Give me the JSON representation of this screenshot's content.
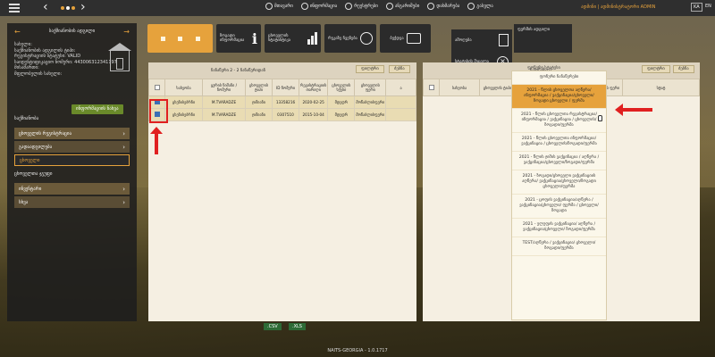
{
  "topbar": {
    "menu": [
      {
        "icon": "home-icon",
        "label": "მთავარი"
      },
      {
        "icon": "info-icon",
        "label": "ინფორმაცია"
      },
      {
        "icon": "list-icon",
        "label": "რეესტრები"
      },
      {
        "icon": "reports-icon",
        "label": "ანგარიშები"
      },
      {
        "icon": "help-icon",
        "label": "დახმარება"
      },
      {
        "icon": "logout-icon",
        "label": "გასვლა"
      }
    ],
    "user": "ადმინი | ადმინისტრატორი ADMIN",
    "lang_ka": "KA",
    "lang_en": "EN"
  },
  "sidebar": {
    "title": "საქმიანობის ადგილი",
    "farm_lines": [
      "სახელი:",
      "საქმიანობის ადგილის ტიპი:",
      "რეგისტრაციის სტატუსი: VALID",
      "საიდენტიფიკაციო ნომერი: 443006312341197",
      "მისამართი:",
      "მფლობელის სახელი:"
    ],
    "green_button": "ინფორმაციის ნახვა",
    "section_label": "საქმიანობა",
    "items": [
      {
        "label": "ცხოველის რეგისტრაცია",
        "style": "normal"
      },
      {
        "label": "გადაადგილება",
        "style": "dark"
      },
      {
        "label": "ცხოველი",
        "style": "active"
      }
    ],
    "section_label_2": "ცხოველთა ჯგუფი",
    "items_2": [
      {
        "label": "ინვენტარი",
        "style": "normal"
      },
      {
        "label": "სხვა",
        "style": "dark"
      }
    ]
  },
  "toolbar": {
    "btn_info": "ზოგადი ინფორმაცია",
    "btn_stats": "ცხოველის სტატისტიკა",
    "btn_map": "რუკაზე ჩვენება",
    "btn_print": "ბეჭდვა",
    "btn_barn": "ფერმის ადგილი"
  },
  "tools": [
    {
      "label": "ამოღება",
      "icon": "clipboard-icon"
    },
    {
      "label": "სტატუსის შეცვლა",
      "icon": "cancel-circle-icon"
    },
    {
      "label": "ცხოველის ტიპი",
      "icon": "folder-icon"
    },
    {
      "label": "გადატანის ლოგი",
      "icon": "refresh-icon"
    }
  ],
  "left_panel": {
    "title": "ჩანაწერი 2 - 2 ჩანაწერიდან",
    "btn_filter": "ფილტრი",
    "btn_clear": "ძებნა",
    "columns": [
      "",
      "სახეობა",
      "ყურის ნიშანი / ნომერი",
      "ცხოველის ტიპი",
      "ID ნომერი",
      "რეგისტრაციის თარიღი",
      "ცხოველის სქესი",
      "ცხოველის ფერი",
      "ა"
    ],
    "rows": [
      [
        "",
        "ცხენისებრნი",
        "M.TVARADZE",
        "ჯიშიანი",
        "13358216",
        "2020-02-25",
        "მდედრ",
        "მოწაბლისფერი",
        ""
      ],
      [
        "",
        "ცხენისებრნი",
        "M.TVARADZE",
        "ჯიშიანი",
        "0307510",
        "2015-10-04",
        "მდედრ",
        "მოწაბლისფერი",
        ""
      ]
    ]
  },
  "right_panel": {
    "title": "ჩანაწერი 0",
    "btn_filter": "ფილტრი",
    "btn_clear": "ძებნა",
    "columns": [
      "",
      "სახეობა",
      "ცხოველის ტიპი",
      "ID",
      "ცხოველის სქესი",
      "ცხოველის ფერი",
      "სტატ"
    ]
  },
  "popup": {
    "caption": "ფონური სტატუსი",
    "first": "ფონური ჩანაწერები",
    "items": [
      "2021 - წლის ცხოველთა აღწერა/ინფორმაცია / ვაქცინაცია/ცხოველი/ზოგადი ცხოველი / ფერმა",
      "2021 - წლის ცხოველთა რეგისტრაცია/ინფორმაცია / ვაქცინაცია / ცხოველის/ზოგადი/ფერმა",
      "2021 - წლის ცხოველთა ინფორმაცია/ვაქცინაცია / ცხოველის/ზოგადი/ფერმა",
      "2021 - წლის ჯიშის ვაქცინაცია / აღწერა / ვაქცინაცია/ცხოველი/ზოგადი/ფერმა",
      "2021 - ზოგადი/ცხოველი ვაქცინაციის აღწერა/ ვაქცინაცია/ცხოველი/ზოგადი ცხოველი/ფერმა",
      "2021 - ცოფის ვაქცინაცია/აღწერა / ვაქცინაცია/ცხოველი/ ფერმა / ცხოველი/ზოგადი",
      "2021 - ულუფის ვაქცინაცია/ აღწერა / ვაქცინაცია/ცხოველი/ ზოგადი/ფერმა",
      "TEST/აღწერა / ვაქცინაცია/ ცხოველი/ზოგადი/ფერმა"
    ],
    "highlighted_index": 0
  },
  "export": {
    "csv": ".CSV",
    "xls": ".XLS"
  },
  "footer": "NAITS-GEORGIA - 1.0.1717",
  "colors": {
    "accent": "#e6a23c",
    "annotation": "#e02020",
    "panel": "#f5efe2"
  }
}
